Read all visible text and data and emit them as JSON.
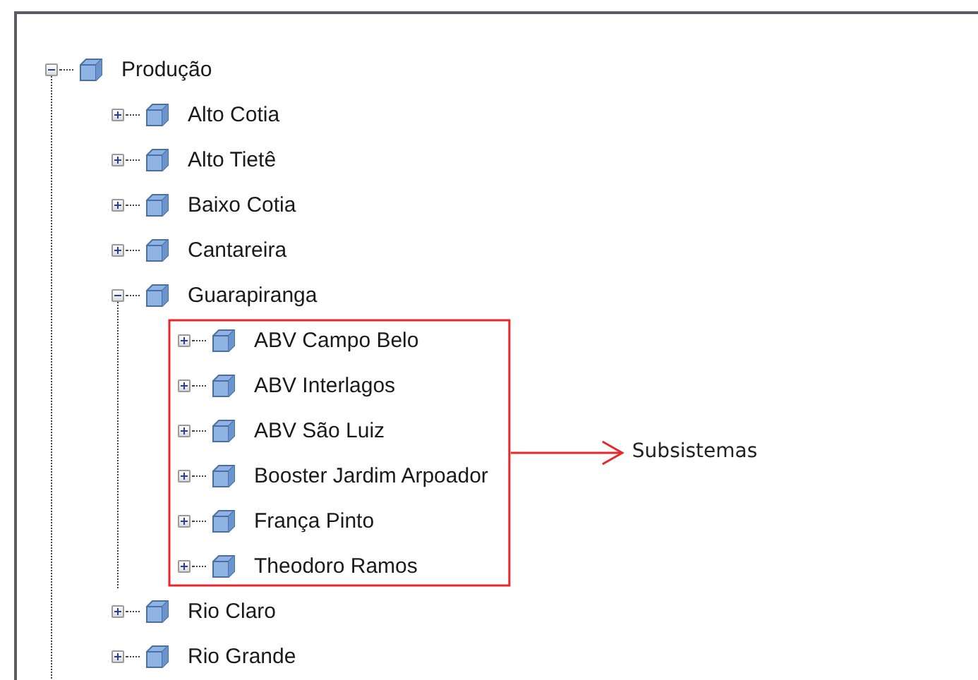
{
  "tree": [
    {
      "label": "Produção",
      "expanded": true,
      "children": [
        {
          "label": "Alto Cotia",
          "expanded": false
        },
        {
          "label": "Alto Tietê",
          "expanded": false
        },
        {
          "label": "Baixo Cotia",
          "expanded": false
        },
        {
          "label": "Cantareira",
          "expanded": false
        },
        {
          "label": "Guarapiranga",
          "expanded": true,
          "callout": "Subsistemas",
          "children": [
            {
              "label": "ABV Campo Belo",
              "expanded": false
            },
            {
              "label": "ABV Interlagos",
              "expanded": false
            },
            {
              "label": "ABV São Luiz",
              "expanded": false
            },
            {
              "label": "Booster Jardim Arpoador",
              "expanded": false
            },
            {
              "label": "França Pinto",
              "expanded": false
            },
            {
              "label": "Theodoro Ramos",
              "expanded": false
            }
          ]
        },
        {
          "label": "Rio Claro",
          "expanded": false
        },
        {
          "label": "Rio Grande",
          "expanded": false
        }
      ]
    }
  ]
}
